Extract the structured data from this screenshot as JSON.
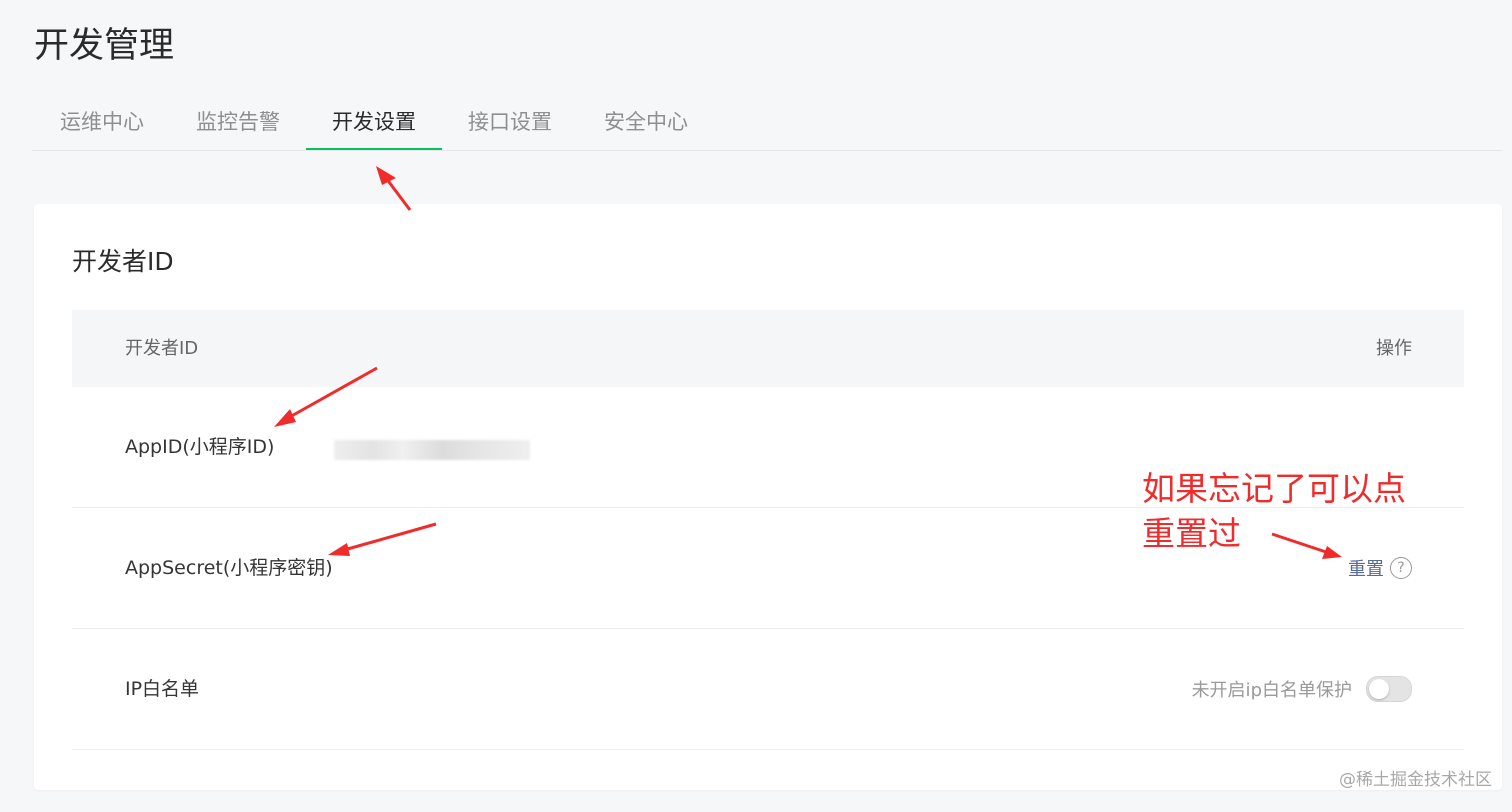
{
  "page": {
    "title": "开发管理"
  },
  "tabs": [
    {
      "label": "运维中心",
      "active": false
    },
    {
      "label": "监控告警",
      "active": false
    },
    {
      "label": "开发设置",
      "active": true
    },
    {
      "label": "接口设置",
      "active": false
    },
    {
      "label": "安全中心",
      "active": false
    }
  ],
  "developer_id": {
    "section_title": "开发者ID",
    "table": {
      "header_name": "开发者ID",
      "header_operation": "操作"
    },
    "rows": {
      "appid": {
        "label": "AppID(小程序ID)"
      },
      "appsecret": {
        "label": "AppSecret(小程序密钥)",
        "reset_label": "重置",
        "help_icon": "?"
      },
      "ip_whitelist": {
        "label": "IP白名单",
        "status_text": "未开启ip白名单保护",
        "enabled": false
      }
    }
  },
  "annotation": {
    "line1": "如果忘记了可以点",
    "line2": "重置过"
  },
  "watermark": "@稀土掘金技术社区",
  "colors": {
    "accent_green": "#07c160",
    "link": "#576b95",
    "annotation_red": "#f02b2b",
    "background": "#f6f7f9"
  }
}
